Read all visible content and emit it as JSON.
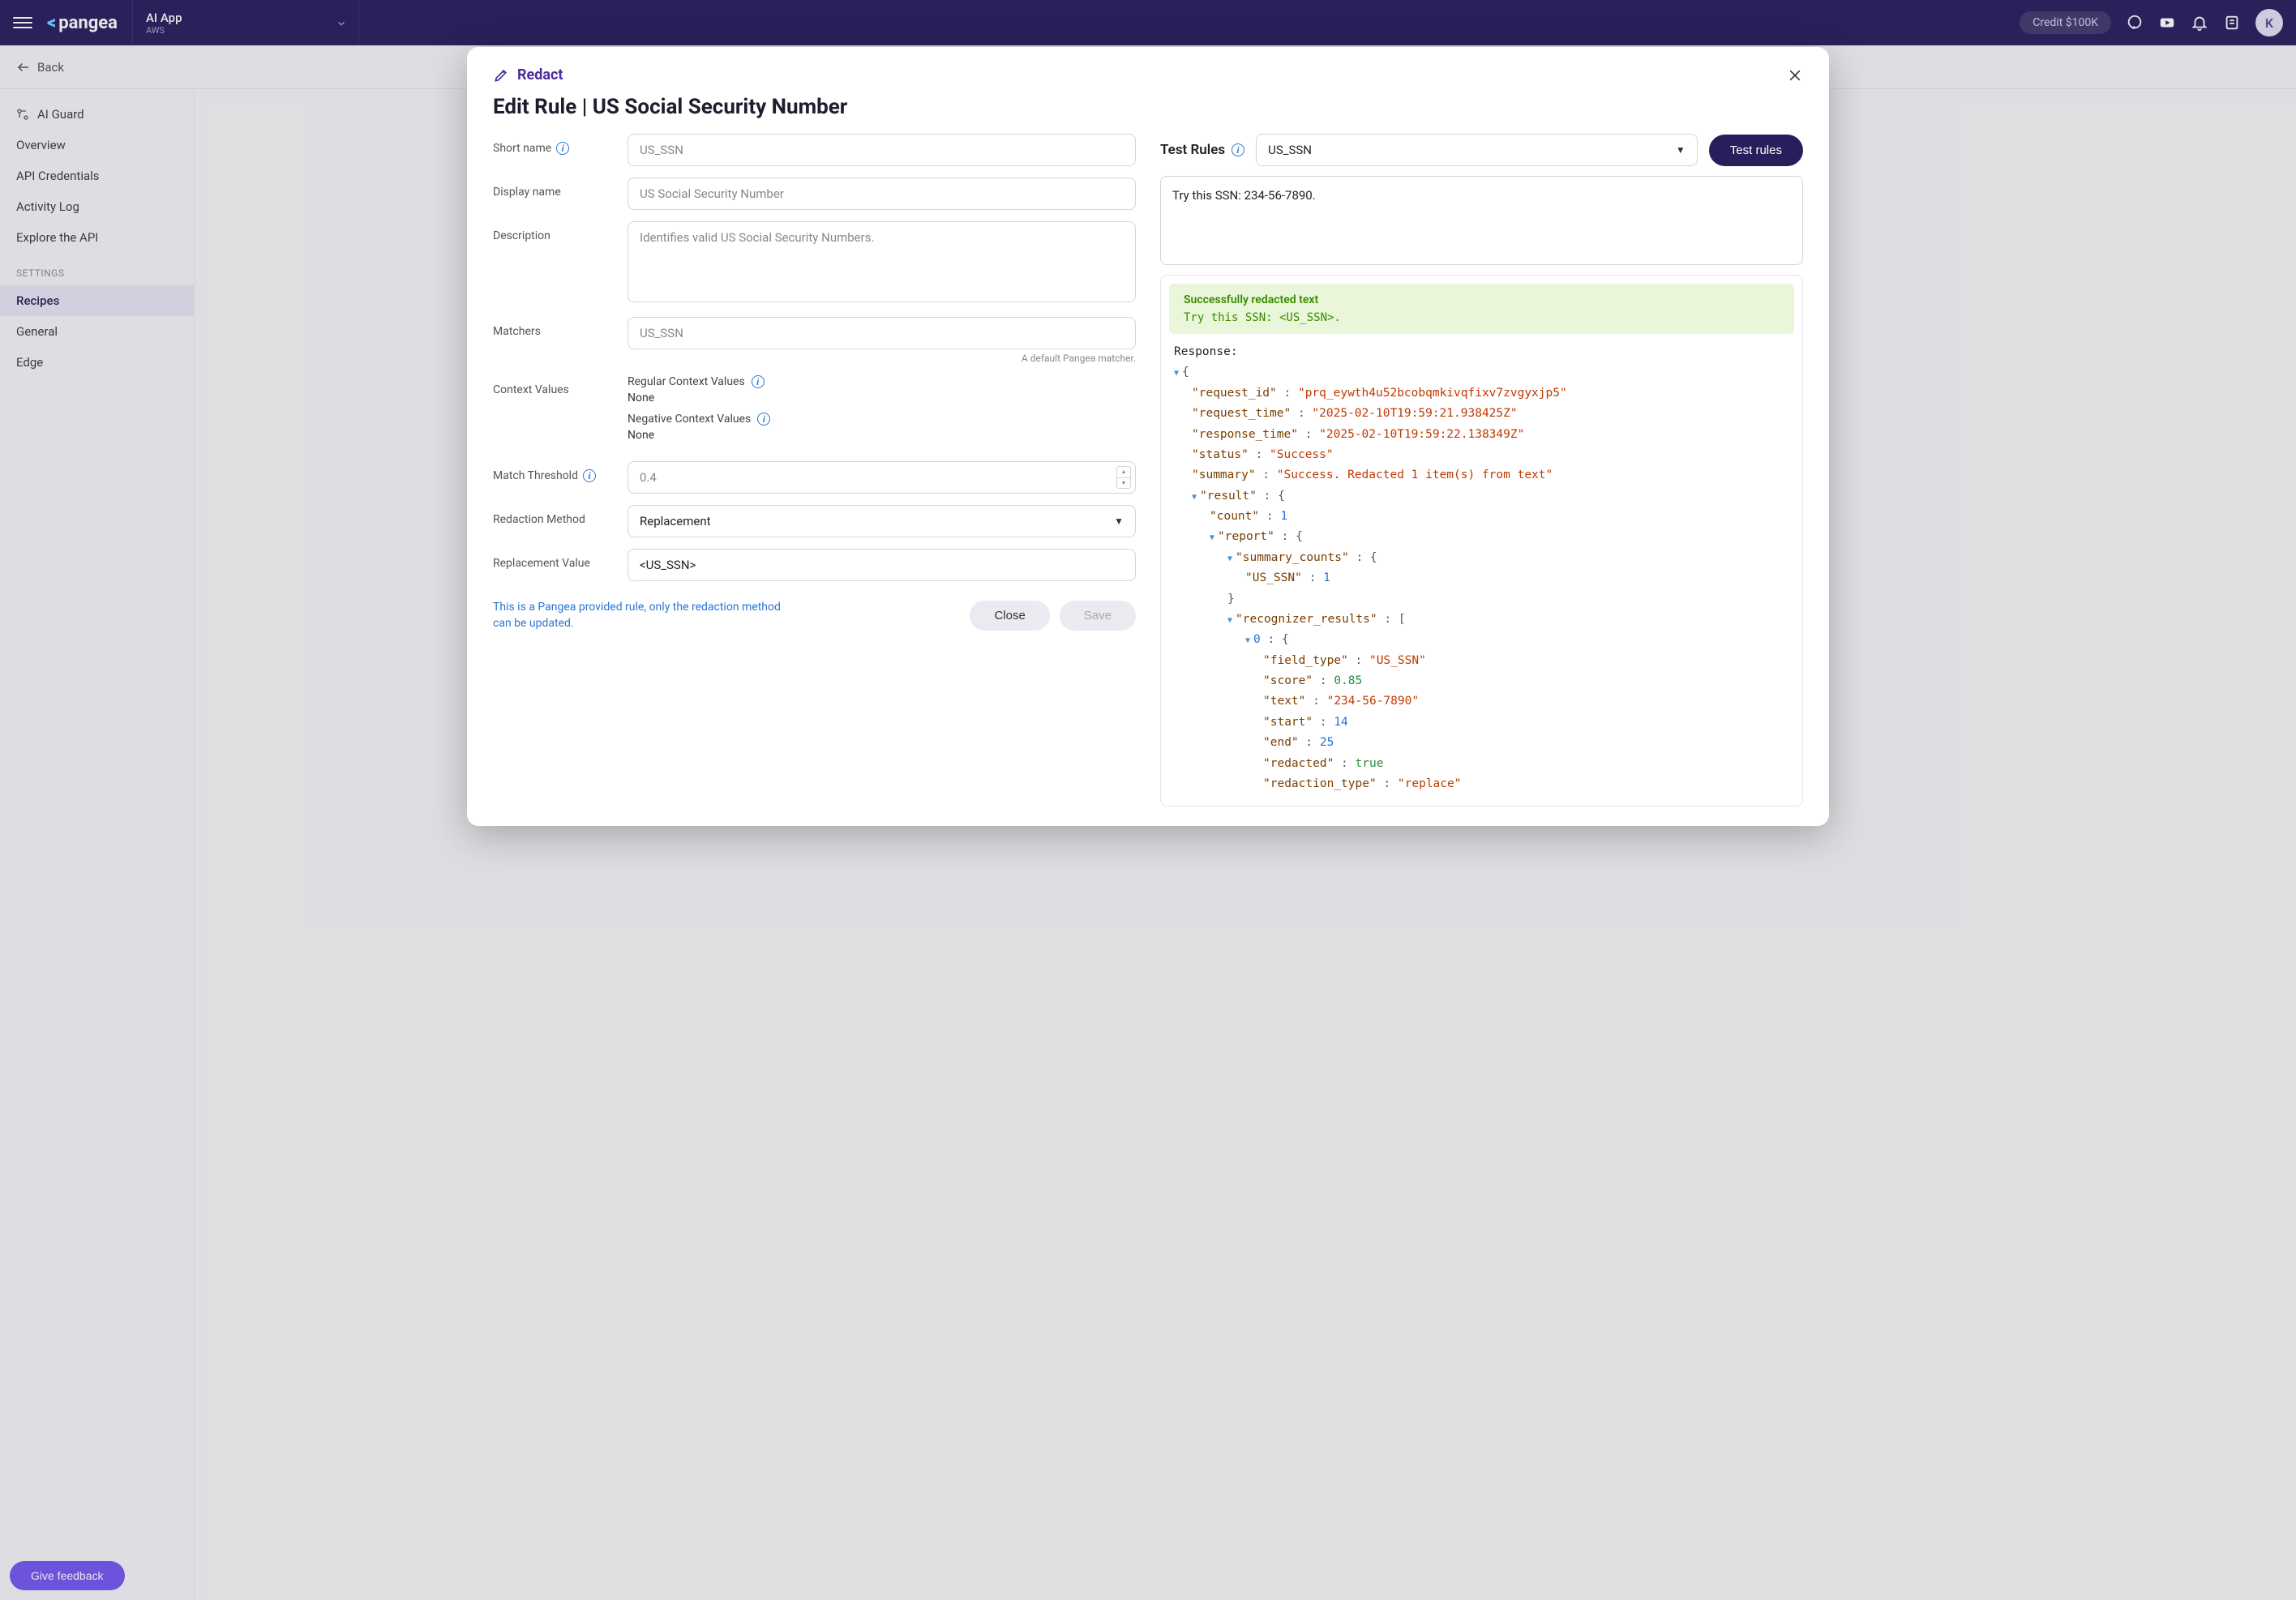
{
  "topbar": {
    "app_title": "AI App",
    "app_sub": "AWS",
    "credit": "Credit $100K",
    "avatar_initial": "K"
  },
  "subheader": {
    "back": "Back"
  },
  "sidebar": {
    "items": [
      "AI Guard",
      "Overview",
      "API Credentials",
      "Activity Log",
      "Explore the API"
    ],
    "settings_label": "SETTINGS",
    "settings_items": [
      "Recipes",
      "General",
      "Edge"
    ]
  },
  "feedback_btn": "Give feedback",
  "modal": {
    "crumb": "Redact",
    "title": "Edit Rule | US Social Security Number",
    "form": {
      "short_name_label": "Short name",
      "short_name_value": "US_SSN",
      "display_name_label": "Display name",
      "display_name_value": "US Social Security Number",
      "description_label": "Description",
      "description_value": "Identifies valid US Social Security Numbers.",
      "matchers_label": "Matchers",
      "matchers_value": "US_SSN",
      "matchers_helper": "A default Pangea matcher.",
      "context_label": "Context Values",
      "regular_ctx_label": "Regular Context Values",
      "regular_ctx_value": "None",
      "negative_ctx_label": "Negative Context Values",
      "negative_ctx_value": "None",
      "threshold_label": "Match Threshold",
      "threshold_value": "0.4",
      "method_label": "Redaction Method",
      "method_value": "Replacement",
      "replacement_label": "Replacement Value",
      "replacement_value": "<US_SSN>",
      "note": "This is a Pangea provided rule, only the redaction method can be updated.",
      "close_btn": "Close",
      "save_btn": "Save"
    },
    "test": {
      "title": "Test Rules",
      "rule_select": "US_SSN",
      "test_btn": "Test rules",
      "try_text": "Try this SSN: 234-56-7890.",
      "success_title": "Successfully redacted text",
      "success_body": "Try this SSN: <US_SSN>.",
      "response_label": "Response:",
      "response": {
        "request_id": "prq_eywth4u52bcobqmkivqfixv7zvgyxjp5",
        "request_time": "2025-02-10T19:59:21.938425Z",
        "response_time": "2025-02-10T19:59:22.138349Z",
        "status": "Success",
        "summary": "Success. Redacted 1 item(s) from text",
        "result_count": 1,
        "summary_counts_key": "US_SSN",
        "summary_counts_val": 1,
        "rr_index": "0",
        "rr_field_type": "US_SSN",
        "rr_score": 0.85,
        "rr_text": "234-56-7890",
        "rr_start": 14,
        "rr_end": 25,
        "rr_redacted": "true",
        "rr_redaction_type": "replace"
      }
    }
  }
}
